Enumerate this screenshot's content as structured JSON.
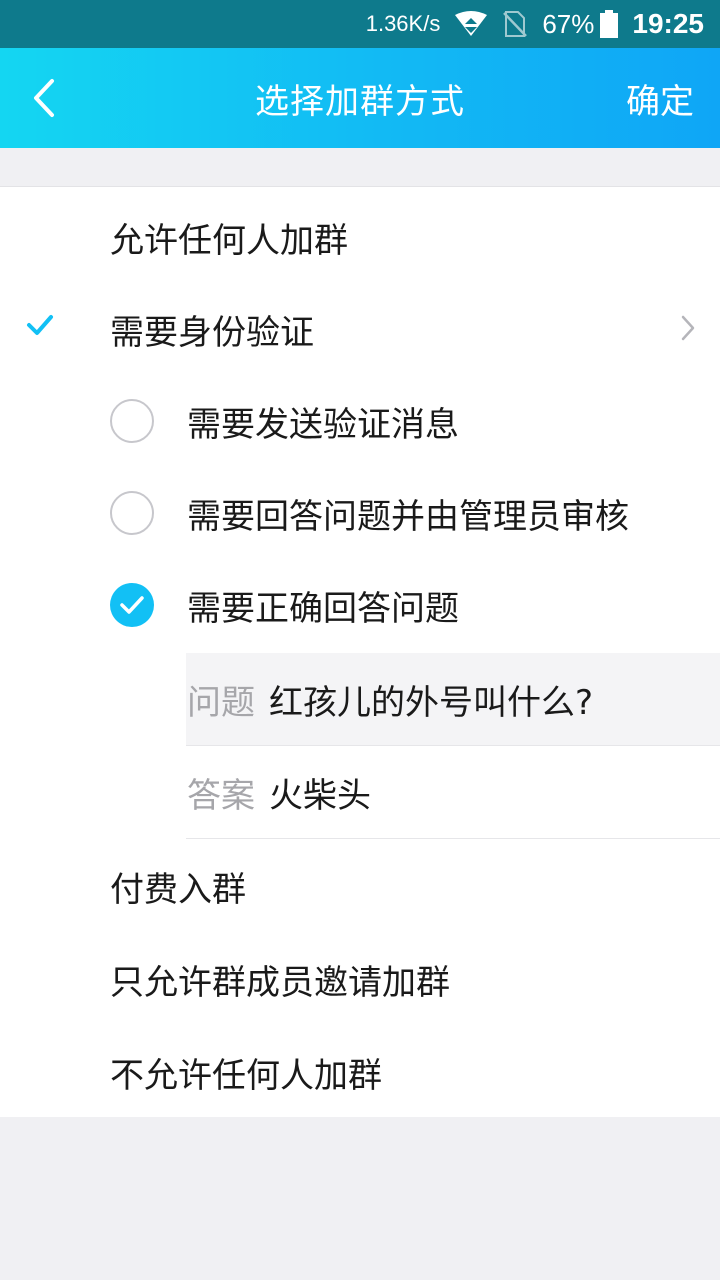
{
  "status_bar": {
    "speed": "1.36K/s",
    "battery": "67%",
    "time": "19:25"
  },
  "header": {
    "title": "选择加群方式",
    "confirm_label": "确定"
  },
  "options": {
    "allow_anyone": "允许任何人加群",
    "need_verify": "需要身份验证",
    "sub_options": [
      {
        "label": "需要发送验证消息",
        "checked": false
      },
      {
        "label": "需要回答问题并由管理员审核",
        "checked": false
      },
      {
        "label": "需要正确回答问题",
        "checked": true
      }
    ],
    "question_key": "问题",
    "question_value": "红孩儿的外号叫什么?",
    "answer_key": "答案",
    "answer_value": "火柴头",
    "paid_join": "付费入群",
    "invite_only": "只允许群成员邀请加群",
    "no_one": "不允许任何人加群"
  },
  "colors": {
    "accent": "#12c0f5",
    "header_start": "#14d6f2",
    "header_end": "#0fa6f6"
  }
}
